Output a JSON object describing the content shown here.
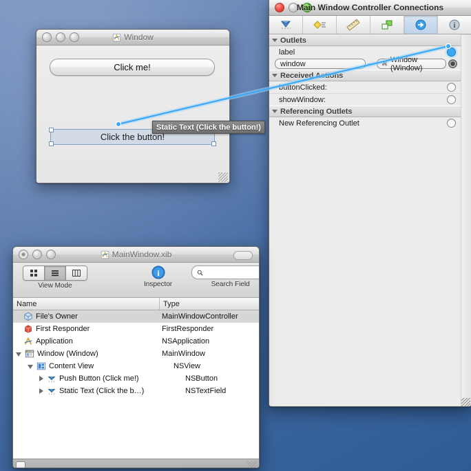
{
  "desktop": {
    "name": "mac-desktop"
  },
  "mock_window": {
    "title": "Window",
    "icon": "xib-document-icon",
    "button_label": "Click me!",
    "static_text": "Click the button!",
    "traffic_lights": [
      "close",
      "minimize",
      "zoom"
    ]
  },
  "tooltip": {
    "text": "Static Text (Click the button!)"
  },
  "inspector": {
    "title": "Main Window Controller Connections",
    "tabs": [
      {
        "name": "attributes-inspector",
        "icon": "blue-gem-icon",
        "selected": false
      },
      {
        "name": "effects-inspector",
        "icon": "yellow-diamond-icon",
        "selected": false
      },
      {
        "name": "size-inspector",
        "icon": "ruler-icon",
        "selected": false
      },
      {
        "name": "bindings-inspector",
        "icon": "green-squares-icon",
        "selected": false
      },
      {
        "name": "connections-inspector",
        "icon": "blue-arrow-icon",
        "selected": true
      },
      {
        "name": "identity-inspector",
        "icon": "info-icon",
        "selected": false
      }
    ],
    "sections": [
      {
        "title": "Outlets",
        "rows": [
          {
            "kind": "outlet",
            "label": "label",
            "well": "lit"
          }
        ],
        "connections": [
          {
            "source": "window",
            "target": "Window (Window)",
            "target_glyph": "⌘",
            "well": "filled"
          }
        ]
      },
      {
        "title": "Received Actions",
        "rows": [
          {
            "kind": "action",
            "label": "buttonClicked:",
            "well": "empty"
          },
          {
            "kind": "action",
            "label": "showWindow:",
            "well": "empty"
          }
        ],
        "connections": []
      },
      {
        "title": "Referencing Outlets",
        "rows": [
          {
            "kind": "outlet",
            "label": "New Referencing Outlet",
            "well": "empty"
          }
        ],
        "connections": []
      }
    ]
  },
  "xib_window": {
    "title": "MainWindow.xib",
    "icon": "xib-document-icon",
    "toolbar": {
      "view_mode": {
        "caption": "View Mode",
        "segments": [
          {
            "name": "icon-view",
            "icon": "grid-icon",
            "selected": false
          },
          {
            "name": "list-view",
            "icon": "list-icon",
            "selected": true
          },
          {
            "name": "column-view",
            "icon": "columns-icon",
            "selected": false
          }
        ]
      },
      "inspector": {
        "caption": "Inspector",
        "icon": "info-icon"
      },
      "search": {
        "caption": "Search Field",
        "placeholder": "",
        "value": "",
        "icon": "search-icon"
      }
    },
    "columns": {
      "name": "Name",
      "type": "Type"
    },
    "rows": [
      {
        "label": "File's Owner",
        "type": "MainWindowController",
        "indent": 0,
        "twist": "none",
        "icon": "files-owner-icon",
        "selected": true
      },
      {
        "label": "First Responder",
        "type": "FirstResponder",
        "indent": 0,
        "twist": "none",
        "icon": "first-responder-icon",
        "selected": false
      },
      {
        "label": "Application",
        "type": "NSApplication",
        "indent": 0,
        "twist": "none",
        "icon": "application-icon",
        "selected": false
      },
      {
        "label": "Window (Window)",
        "type": "MainWindow",
        "indent": 0,
        "twist": "open",
        "icon": "window-icon",
        "selected": false
      },
      {
        "label": "Content View",
        "type": "NSView",
        "indent": 1,
        "twist": "open",
        "icon": "view-icon",
        "selected": false
      },
      {
        "label": "Push Button (Click me!)",
        "type": "NSButton",
        "indent": 2,
        "twist": "closed",
        "icon": "object-icon",
        "selected": false
      },
      {
        "label": "Static Text (Click the b…)",
        "type": "NSTextField",
        "indent": 2,
        "twist": "closed",
        "icon": "object-icon",
        "selected": false
      }
    ]
  },
  "colors": {
    "desktop_blue": "#3f679f",
    "wire_blue": "#3da9f5",
    "selection_gray": "#d6d6d6",
    "tab_selected": "#bed2ea"
  }
}
